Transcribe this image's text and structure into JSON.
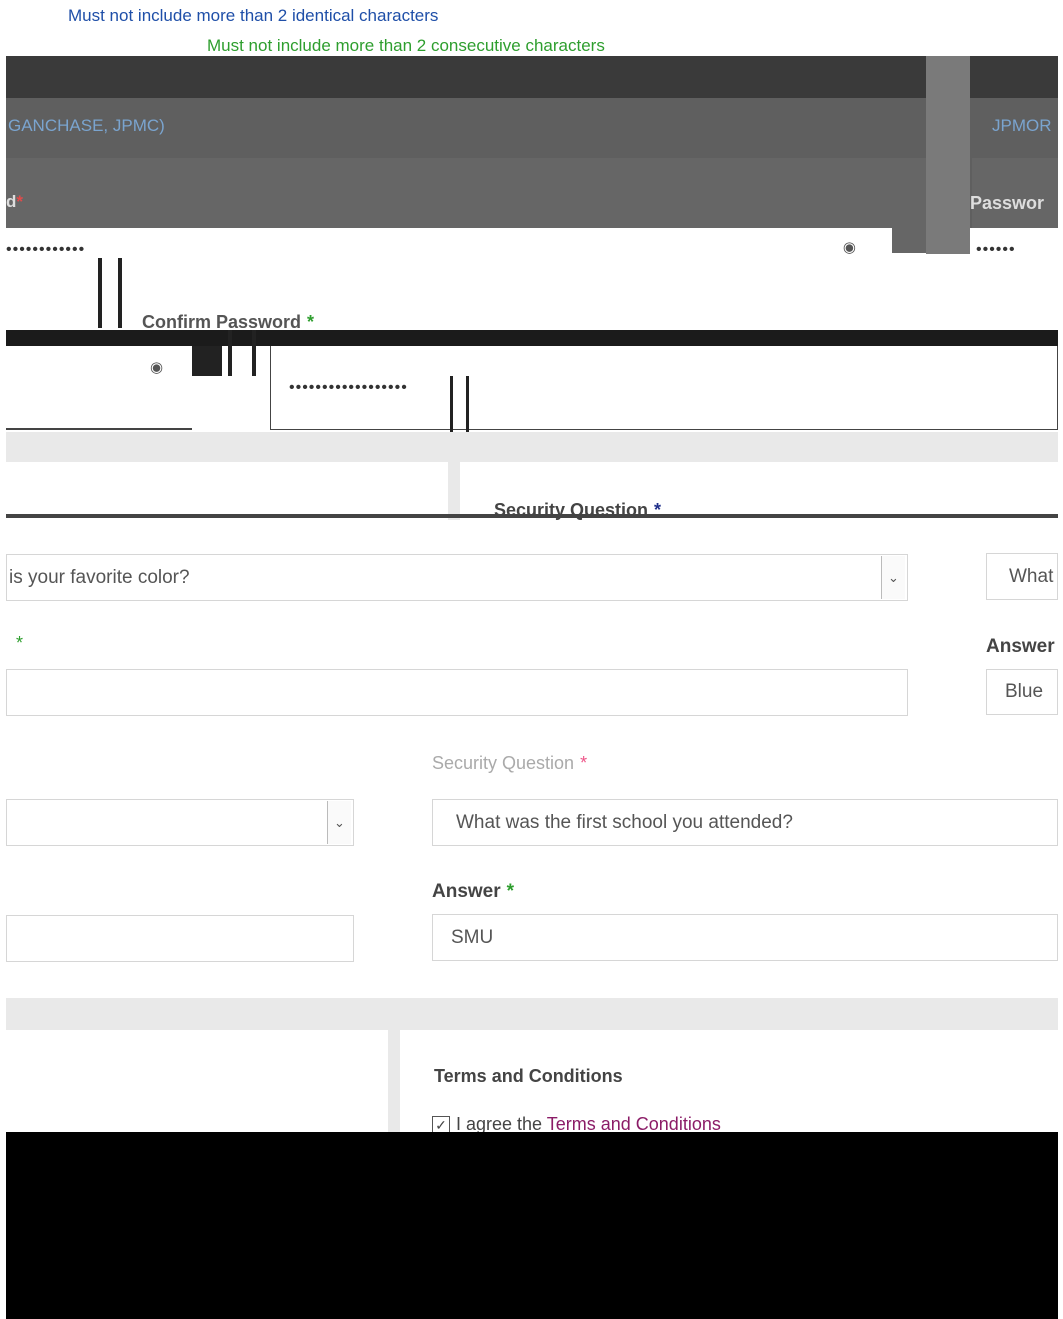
{
  "password_rules": {
    "rule_identical": "Must not include more than 2 identical characters",
    "rule_consecutive": "Must not include more than 2 consecutive characters"
  },
  "company": {
    "left_value": "GANCHASE, JPMC)",
    "right_value": "JPMOR"
  },
  "password": {
    "left_label_fragment": "d",
    "right_label": "Passwor",
    "mask_left": "••••••••••••",
    "mask_right": "••••••"
  },
  "confirm_password": {
    "label": "Confirm Password",
    "mask": "••••••••••••••••••"
  },
  "security_q1": {
    "label": "Security Question",
    "selected": " is your favorite color?",
    "answer_label_fragment": "",
    "answer_value": ""
  },
  "security_q_right": {
    "selected_fragment": "What",
    "answer_label": "Answer",
    "answer_value": "Blue"
  },
  "security_q3": {
    "label": "Security Question",
    "selected": "What was the first school you attended?",
    "answer_label": "Answer",
    "answer_value": "SMU"
  },
  "terms": {
    "title": "Terms and Conditions",
    "agree_prefix": "I agree the ",
    "agree_link": "Terms and Conditions"
  },
  "required_mark": "*",
  "colors": {
    "band_gray": "#e9e9e9",
    "dark_panel": "#5f5f5f",
    "link_purple": "#8b1c67",
    "rule_blue": "#1f4fa8",
    "rule_green": "#2e9e2e"
  }
}
